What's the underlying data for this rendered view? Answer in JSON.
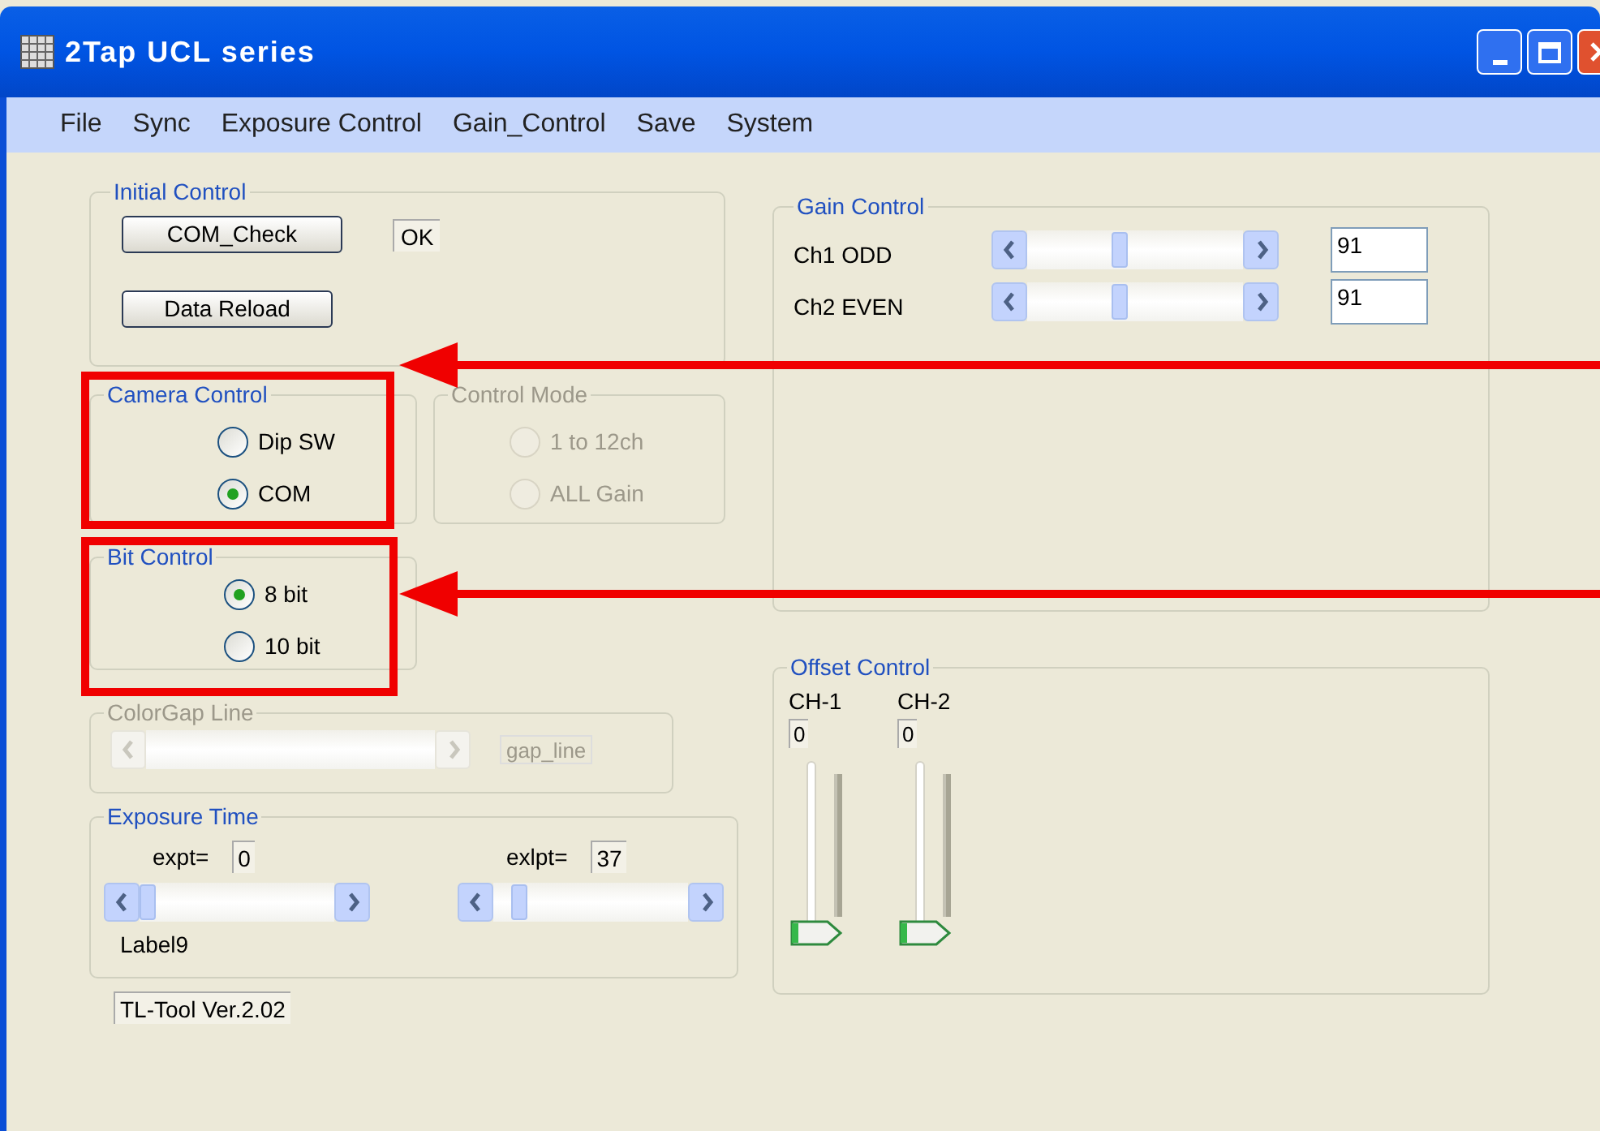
{
  "window": {
    "title": "2Tap UCL series"
  },
  "menu": [
    "File",
    "Sync",
    "Exposure Control",
    "Gain_Control",
    "Save",
    "System"
  ],
  "initial_control": {
    "title": "Initial Control",
    "buttons": [
      "COM_Check",
      "Data Reload"
    ],
    "status": "OK"
  },
  "camera_control": {
    "title": "Camera Control",
    "options": [
      {
        "label": "Dip SW",
        "selected": false
      },
      {
        "label": "COM",
        "selected": true
      }
    ]
  },
  "control_mode": {
    "title": "Control Mode",
    "disabled": true,
    "options": [
      {
        "label": "1 to 12ch",
        "selected": false
      },
      {
        "label": "ALL Gain",
        "selected": false
      }
    ]
  },
  "bit_control": {
    "title": "Bit Control",
    "options": [
      {
        "label": "8 bit",
        "selected": true
      },
      {
        "label": "10 bit",
        "selected": false
      }
    ]
  },
  "colorgap_line": {
    "title": "ColorGap Line",
    "disabled": true,
    "field": "gap_line"
  },
  "exposure_time": {
    "title": "Exposure Time",
    "sliders": [
      {
        "label": "expt=",
        "value": "0",
        "level": 0
      },
      {
        "label": "exlpt=",
        "value": "37",
        "level": 0.1
      }
    ],
    "note": "Label9"
  },
  "version": "TL-Tool Ver.2.02",
  "gain_control": {
    "title": "Gain Control",
    "channels": [
      {
        "name": "Ch1 ODD",
        "level": 0.42,
        "value": "91"
      },
      {
        "name": "Ch2 EVEN",
        "level": 0.42,
        "value": "91"
      }
    ]
  },
  "offset_control": {
    "title": "Offset Control",
    "channels": [
      {
        "name": "CH-1",
        "value": "0",
        "level": 0
      },
      {
        "name": "CH-2",
        "value": "0",
        "level": 0
      }
    ]
  }
}
